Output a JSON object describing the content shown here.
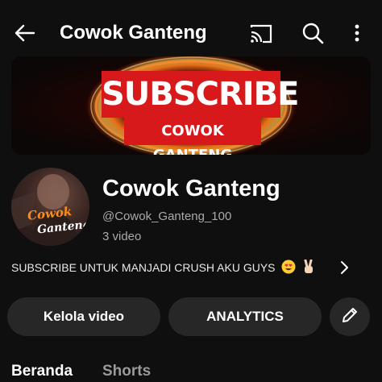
{
  "header": {
    "title": "Cowok Ganteng",
    "icons": [
      "back-arrow-icon",
      "cast-icon",
      "search-icon",
      "more-vertical-icon"
    ]
  },
  "banner": {
    "line1": "SUBSCRIBE",
    "line2": "COWOK GANTENG"
  },
  "avatar": {
    "text_line1": "Cowok",
    "text_line2": "Ganteng"
  },
  "channel": {
    "name": "Cowok Ganteng",
    "handle": "@Cowok_Ganteng_100",
    "video_count": "3 video"
  },
  "description": {
    "text": "SUBSCRIBE UNTUK MANJADI CRUSH AKU GUYS"
  },
  "actions": {
    "manage_label": "Kelola video",
    "analytics_label": "ANALYTICS",
    "edit_icon": "pencil-icon"
  },
  "tabs": [
    {
      "label": "Beranda",
      "active": true
    },
    {
      "label": "Shorts",
      "active": false
    }
  ],
  "colors": {
    "background": "#0f0f0f",
    "button_bg": "#272727",
    "banner_red": "#d7191b",
    "fire_orange": "#ff7a1a"
  }
}
